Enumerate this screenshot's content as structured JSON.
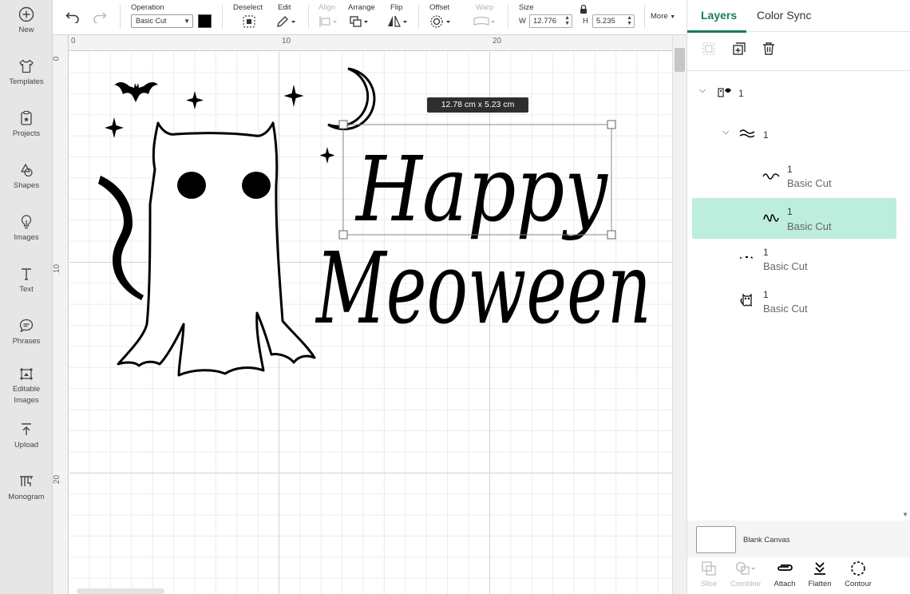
{
  "sidebar": {
    "items": [
      {
        "label": "New",
        "icon": "plus-circle-icon"
      },
      {
        "label": "Templates",
        "icon": "tshirt-icon"
      },
      {
        "label": "Projects",
        "icon": "projects-icon"
      },
      {
        "label": "Shapes",
        "icon": "shapes-icon"
      },
      {
        "label": "Images",
        "icon": "lightbulb-icon"
      },
      {
        "label": "Text",
        "icon": "text-icon"
      },
      {
        "label": "Phrases",
        "icon": "speech-bubble-icon"
      },
      {
        "label": "Editable",
        "label2": "Images",
        "icon": "editable-images-icon"
      },
      {
        "label": "Upload",
        "icon": "upload-icon"
      },
      {
        "label": "Monogram",
        "icon": "monogram-icon"
      }
    ]
  },
  "toolbar": {
    "operation_label": "Operation",
    "operation_value": "Basic Cut",
    "deselect_label": "Deselect",
    "edit_label": "Edit",
    "align_label": "Align",
    "arrange_label": "Arrange",
    "flip_label": "Flip",
    "offset_label": "Offset",
    "warp_label": "Warp",
    "size_label": "Size",
    "w_label": "W",
    "w_value": "12.776",
    "h_label": "H",
    "h_value": "5.235",
    "more_label": "More",
    "swatch_color": "#000000"
  },
  "canvas": {
    "ruler_top": [
      "0",
      "10",
      "20"
    ],
    "ruler_left": [
      "0",
      "10",
      "20"
    ],
    "dimension_tooltip": "12.78  cm x 5.23  cm",
    "artwork_text_line1": "Happy",
    "artwork_text_line2": "Meoween"
  },
  "panel": {
    "tabs": [
      "Layers",
      "Color Sync"
    ],
    "active_tab": "Layers",
    "layers": [
      {
        "name": "1",
        "level": 0,
        "icon": "group-thumbnail-icon"
      },
      {
        "name": "1",
        "level": 1,
        "icon": "text-group-thumbnail-icon"
      },
      {
        "name": "1",
        "operation": "Basic Cut",
        "level": 2,
        "icon": "meoween-thumbnail-icon"
      },
      {
        "name": "1",
        "operation": "Basic Cut",
        "level": 2,
        "icon": "happy-thumbnail-icon",
        "selected": true
      },
      {
        "name": "1",
        "operation": "Basic Cut",
        "level": 1,
        "icon": "stars-thumbnail-icon"
      },
      {
        "name": "1",
        "operation": "Basic Cut",
        "level": 1,
        "icon": "cat-ghost-thumbnail-icon"
      }
    ],
    "canvas_label": "Blank Canvas",
    "bottom_tools": [
      {
        "label": "Slice",
        "disabled": true
      },
      {
        "label": "Combine",
        "disabled": true
      },
      {
        "label": "Attach",
        "disabled": false
      },
      {
        "label": "Flatten",
        "disabled": false
      },
      {
        "label": "Contour",
        "disabled": false
      }
    ]
  },
  "colors": {
    "accent": "#1a7a5c",
    "selected_layer": "#bdeedd",
    "sidebar_bg": "#e6e6e6"
  }
}
